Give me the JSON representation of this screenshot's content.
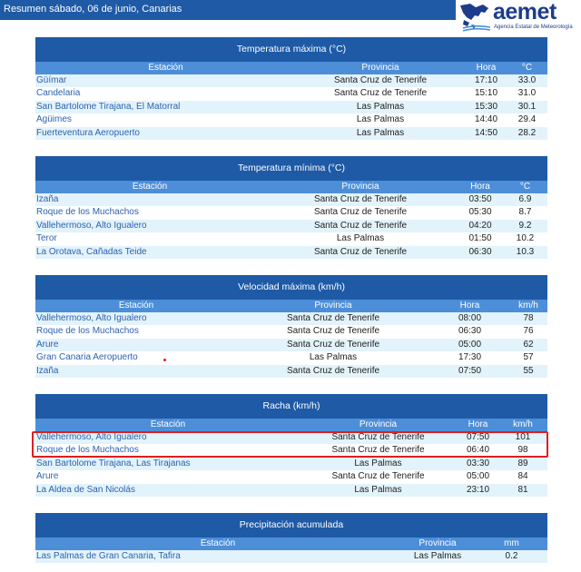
{
  "header": {
    "title": "Resumen sábado, 06 de junio, Canarias"
  },
  "logo": {
    "name": "aemet",
    "subtitle": "Agencia Estatal de Meteorología",
    "icon": "aemet-logo-icon",
    "brand_color": "#1d3c8c"
  },
  "colors": {
    "title_bg": "#1e5aa6",
    "header_bg": "#4d8ed8",
    "alt_row": "#e3f3fb",
    "link": "#2c62b0",
    "highlight": "#e01e1e"
  },
  "tables": [
    {
      "title": "Temperatura máxima (°C)",
      "columns": [
        "Estación",
        "Provincia",
        "Hora",
        "°C"
      ],
      "rows": [
        [
          "Güímar",
          "Santa Cruz de Tenerife",
          "17:10",
          "33.0"
        ],
        [
          "Candelaria",
          "Santa Cruz de Tenerife",
          "15:10",
          "31.0"
        ],
        [
          "San Bartolome Tirajana, El Matorral",
          "Las Palmas",
          "15:30",
          "30.1"
        ],
        [
          "Agüimes",
          "Las Palmas",
          "14:40",
          "29.4"
        ],
        [
          "Fuerteventura Aeropuerto",
          "Las Palmas",
          "14:50",
          "28.2"
        ]
      ]
    },
    {
      "title": "Temperatura mínima (°C)",
      "columns": [
        "Estación",
        "Provincia",
        "Hora",
        "°C"
      ],
      "rows": [
        [
          "Izaña",
          "Santa Cruz de Tenerife",
          "03:50",
          "6.9"
        ],
        [
          "Roque de los Muchachos",
          "Santa Cruz de Tenerife",
          "05:30",
          "8.7"
        ],
        [
          "Vallehermoso, Alto Igualero",
          "Santa Cruz de Tenerife",
          "04:20",
          "9.2"
        ],
        [
          "Teror",
          "Las Palmas",
          "01:50",
          "10.2"
        ],
        [
          "La Orotava, Cañadas Teide",
          "Santa Cruz de Tenerife",
          "06:30",
          "10.3"
        ]
      ]
    },
    {
      "title": "Velocidad máxima (km/h)",
      "columns": [
        "Estación",
        "Provincia",
        "Hora",
        "km/h"
      ],
      "rows": [
        [
          "Vallehermoso, Alto Igualero",
          "Santa Cruz de Tenerife",
          "08:00",
          "78"
        ],
        [
          "Roque de los Muchachos",
          "Santa Cruz de Tenerife",
          "06:30",
          "76"
        ],
        [
          "Arure",
          "Santa Cruz de Tenerife",
          "05:00",
          "62"
        ],
        [
          "Gran Canaria Aeropuerto",
          "Las Palmas",
          "17:30",
          "57"
        ],
        [
          "Izaña",
          "Santa Cruz de Tenerife",
          "07:50",
          "55"
        ]
      ]
    },
    {
      "title": "Racha (km/h)",
      "columns": [
        "Estación",
        "Provincia",
        "Hora",
        "km/h"
      ],
      "rows": [
        [
          "Vallehermoso, Alto Igualero",
          "Santa Cruz de Tenerife",
          "07:50",
          "101"
        ],
        [
          "Roque de los Muchachos",
          "Santa Cruz de Tenerife",
          "06:40",
          "98"
        ],
        [
          "San Bartolome Tirajana, Las Tirajanas",
          "Las Palmas",
          "03:30",
          "89"
        ],
        [
          "Arure",
          "Santa Cruz de Tenerife",
          "05:00",
          "84"
        ],
        [
          "La Aldea de San Nicolás",
          "Las Palmas",
          "23:10",
          "81"
        ]
      ]
    },
    {
      "title": "Precipitación acumulada",
      "columns": [
        "Estación",
        "Provincia",
        "mm"
      ],
      "rows": [
        [
          "Las Palmas de Gran Canaria, Tafira",
          "Las Palmas",
          "0.2"
        ]
      ]
    }
  ]
}
